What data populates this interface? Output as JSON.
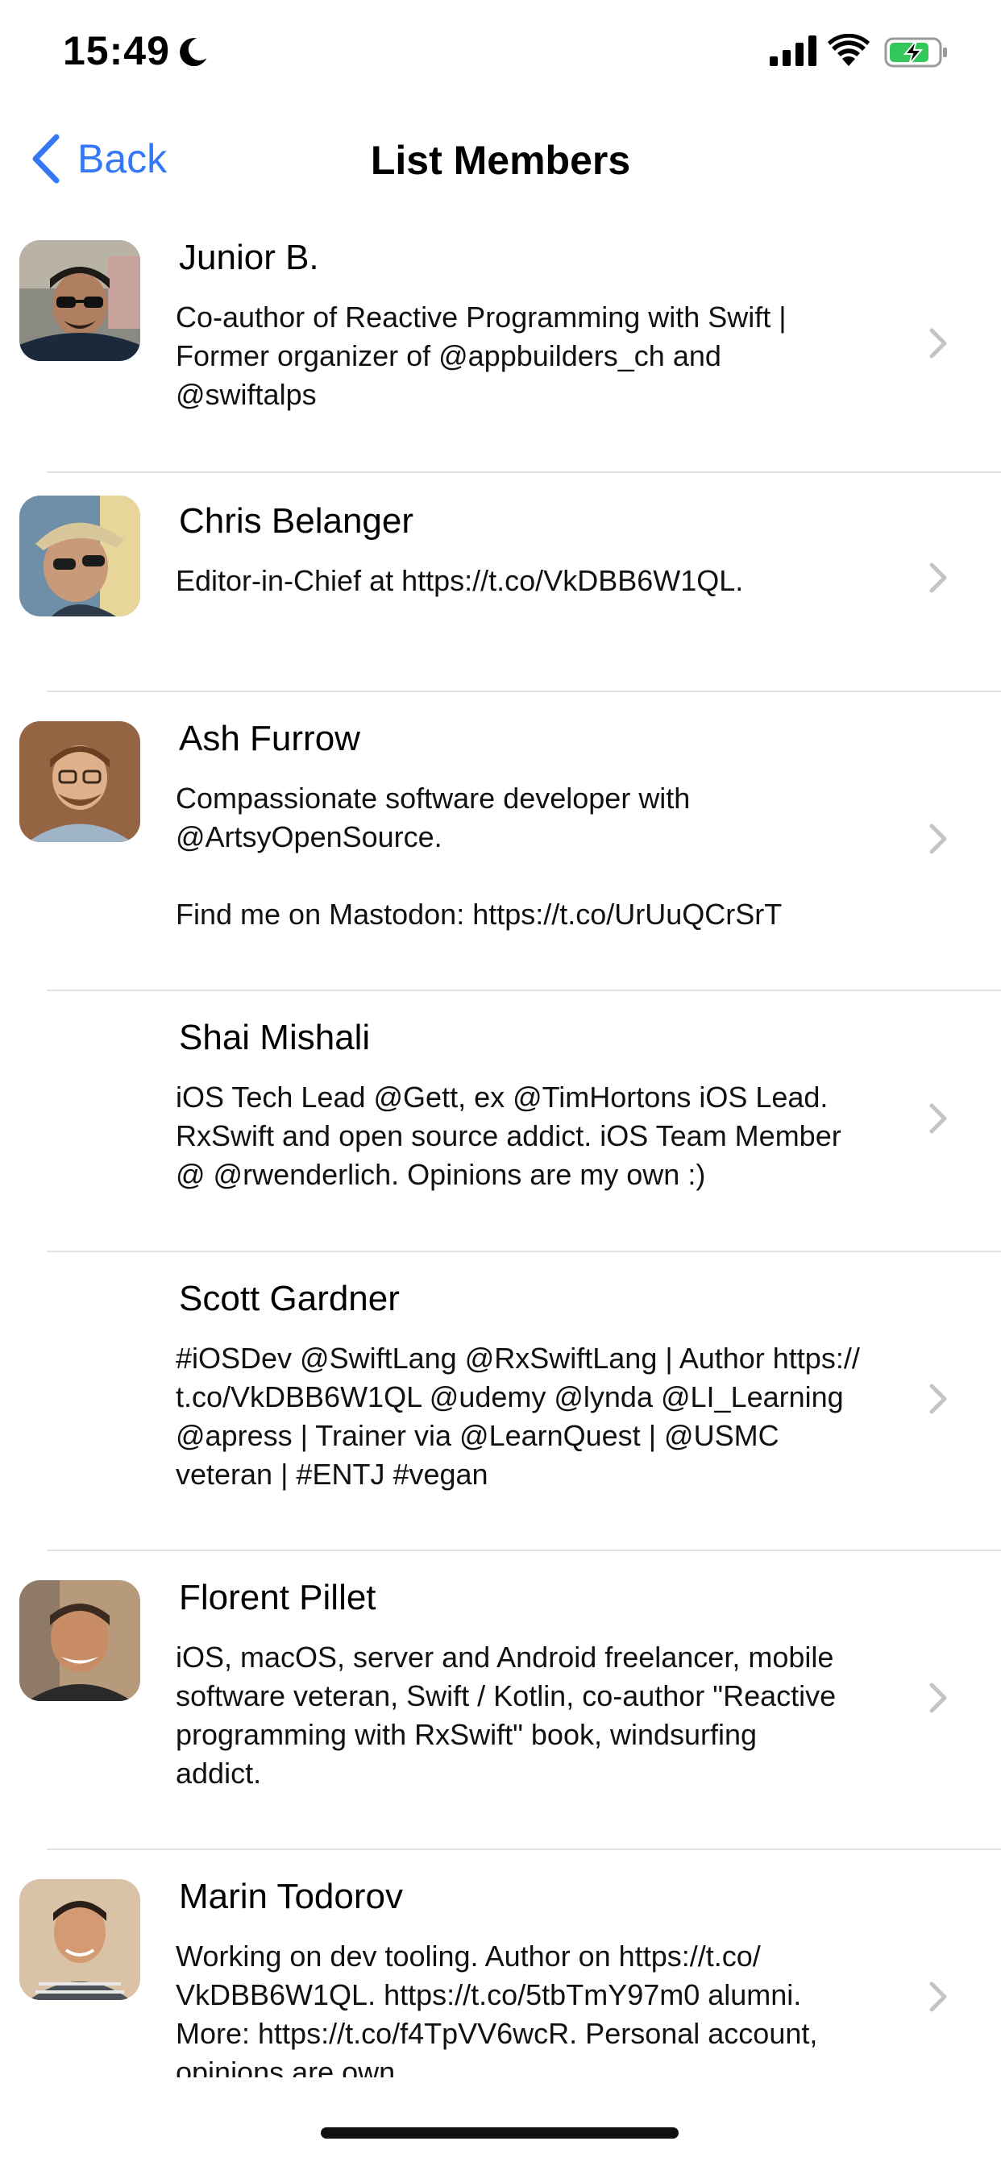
{
  "status_bar": {
    "time": "15:49",
    "icons": [
      "moon-icon",
      "cellular-signal-icon",
      "wifi-icon",
      "battery-charging-icon"
    ],
    "battery_color": "#34c759"
  },
  "nav": {
    "back_label": "Back",
    "title": "List Members",
    "accent_color": "#3478f6"
  },
  "members": [
    {
      "name": "Junior B.",
      "bio": "Co-author of Reactive Programming with Swift |\nFormer organizer of @appbuilders_ch and\n@swiftalps",
      "has_avatar": true
    },
    {
      "name": "Chris Belanger",
      "bio": "Editor-in-Chief at https://t.co/VkDBB6W1QL.",
      "has_avatar": true
    },
    {
      "name": "Ash Furrow",
      "bio": "Compassionate software developer with\n@ArtsyOpenSource.\n\nFind me on Mastodon: https://t.co/UrUuQCrSrT",
      "has_avatar": true
    },
    {
      "name": "Shai Mishali",
      "bio": "iOS Tech Lead @Gett, ex @TimHortons iOS Lead.\nRxSwift and open source addict. iOS Team Member\n@ @rwenderlich. Opinions are my own :)",
      "has_avatar": false
    },
    {
      "name": "Scott Gardner",
      "bio": "#iOSDev @SwiftLang @RxSwiftLang | Author https://\nt.co/VkDBB6W1QL @udemy @lynda @LI_Learning\n@apress |  Trainer via @LearnQuest | @USMC\nveteran | #ENTJ #vegan",
      "has_avatar": false
    },
    {
      "name": "Florent Pillet",
      "bio": "iOS, macOS, server and Android freelancer, mobile\nsoftware veteran, Swift / Kotlin, co-author \"Reactive\nprogramming with RxSwift\" book, windsurfing\naddict.",
      "has_avatar": true
    },
    {
      "name": "Marin Todorov",
      "bio": "Working on  dev tooling. Author on https://t.co/\nVkDBB6W1QL. https://t.co/5tbTmY97m0 alumni.\nMore: https://t.co/f4TpVV6wcR. Personal account,\nopinions are own.",
      "has_avatar": true
    }
  ]
}
